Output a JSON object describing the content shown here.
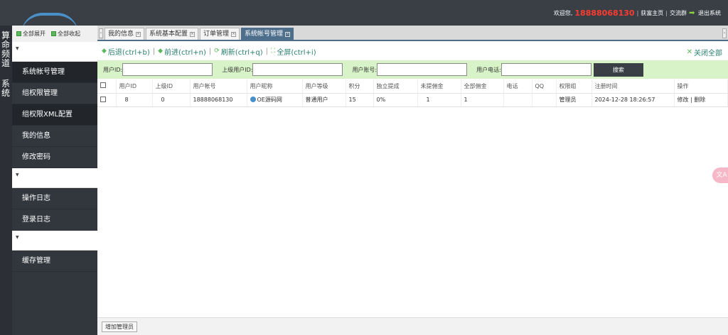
{
  "header": {
    "welcome": "欢迎您,",
    "phone": "18888068130",
    "links": [
      "获富主页",
      "交流群"
    ],
    "logout": "退出系统"
  },
  "channel": {
    "labels": [
      "算命频道",
      "系统"
    ]
  },
  "sidebar": {
    "expand_all": "全部展开",
    "collapse_all": "全部收起",
    "group1_items": [
      "系统帐号管理",
      "组权限管理",
      "组权限XML配置",
      "我的信息",
      "修改密码"
    ],
    "group2_items": [
      "操作日志",
      "登录日志"
    ],
    "group3_items": [
      "缓存管理"
    ]
  },
  "tabs": [
    {
      "label": "我的信息"
    },
    {
      "label": "系统基本配置"
    },
    {
      "label": "订单管理"
    },
    {
      "label": "系统帐号管理"
    }
  ],
  "toolbar": {
    "back": "后退(ctrl+b)",
    "forward": "前进(ctrl+n)",
    "refresh": "刷新(ctrl+q)",
    "fullscreen": "全屏(ctrl+i)",
    "close_all": "关闭全部"
  },
  "search": {
    "user_id_label": "用户ID:",
    "parent_id_label": "上级用户ID:",
    "account_label": "用户账号:",
    "phone_label": "用户电话:",
    "button": "搜索"
  },
  "table": {
    "headers": [
      "用户ID",
      "上级ID",
      "用户帐号",
      "用户昵称",
      "用户等级",
      "积分",
      "独立提成",
      "未提佣金",
      "全部佣金",
      "电话",
      "QQ",
      "权限组",
      "注册时间",
      "操作"
    ],
    "rows": [
      {
        "user_id": "8",
        "parent_id": "0",
        "account": "18888068130",
        "nickname": "OE源码网",
        "level": "普通用户",
        "points": "15",
        "commission_rate": "0%",
        "unwithdrawn": "1",
        "total_commission": "1",
        "phone": "",
        "qq": "",
        "group": "管理员",
        "reg_time": "2024-12-28 18:26:57",
        "edit": "修改",
        "delete": "删除"
      }
    ]
  },
  "bottom": {
    "add_admin": "增加管理员"
  },
  "floating": {
    "label": "文A"
  },
  "colors": {
    "header_bg": "#3a3f46",
    "sidebar_bg": "#32373e",
    "accent_red": "#ff3b30",
    "search_bg": "#d8f3c8",
    "tab_active": "#4d6f8c",
    "link_green": "#2a7f6f"
  }
}
